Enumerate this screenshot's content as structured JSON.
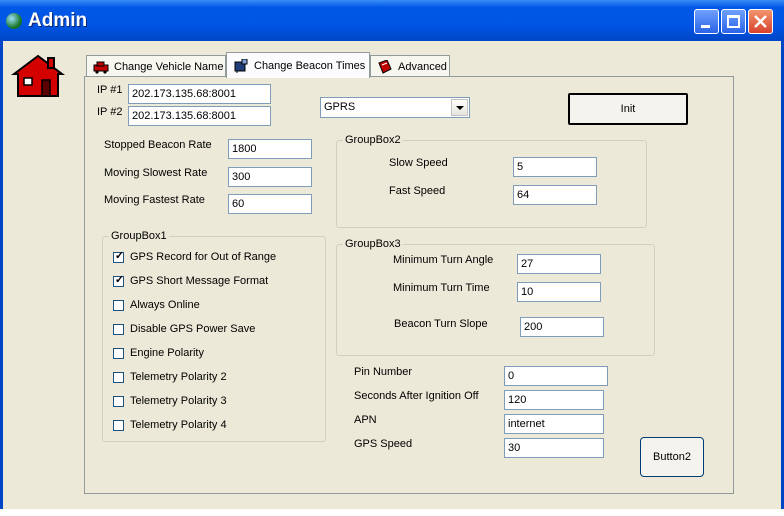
{
  "window": {
    "title": "Admin"
  },
  "tabs": [
    {
      "label": "Change Vehicle Name",
      "icon": "car-icon"
    },
    {
      "label": "Change Beacon Times",
      "icon": "beacon-icon"
    },
    {
      "label": "Advanced",
      "icon": "book-icon"
    }
  ],
  "ip": {
    "ip1_label": "IP #1",
    "ip1_value": "202.173.135.68:8001",
    "ip2_label": "IP #2",
    "ip2_value": "202.173.135.68:8001"
  },
  "connection": {
    "selected": "GPRS"
  },
  "init_label": "Init",
  "rates": {
    "stopped_label": "Stopped Beacon Rate",
    "stopped_value": "1800",
    "slowest_label": "Moving Slowest Rate",
    "slowest_value": "300",
    "fastest_label": "Moving Fastest Rate",
    "fastest_value": "60"
  },
  "groupbox1": {
    "title": "GroupBox1",
    "items": [
      {
        "label": "GPS Record for Out of Range",
        "checked": true
      },
      {
        "label": "GPS Short Message Format",
        "checked": true
      },
      {
        "label": "Always Online",
        "checked": false
      },
      {
        "label": "Disable GPS Power Save",
        "checked": false
      },
      {
        "label": "Engine Polarity",
        "checked": false
      },
      {
        "label": "Telemetry Polarity 2",
        "checked": false
      },
      {
        "label": "Telemetry Polarity 3",
        "checked": false
      },
      {
        "label": "Telemetry Polarity 4",
        "checked": false
      }
    ]
  },
  "groupbox2": {
    "title": "GroupBox2",
    "slow_label": "Slow Speed",
    "slow_value": "5",
    "fast_label": "Fast Speed",
    "fast_value": "64"
  },
  "groupbox3": {
    "title": "GroupBox3",
    "angle_label": "Minimum Turn Angle",
    "angle_value": "27",
    "time_label": "Minimum Turn Time",
    "time_value": "10",
    "slope_label": "Beacon Turn Slope",
    "slope_value": "200"
  },
  "misc": {
    "pin_label": "Pin Number",
    "pin_value": "0",
    "ign_label": "Seconds After Ignition Off",
    "ign_value": "120",
    "apn_label": "APN",
    "apn_value": "internet",
    "gps_label": "GPS Speed",
    "gps_value": "30"
  },
  "button2_label": "Button2",
  "colors": {
    "titlebar": "#0055E5",
    "face": "#ECE9D8",
    "house": "#D40000"
  }
}
